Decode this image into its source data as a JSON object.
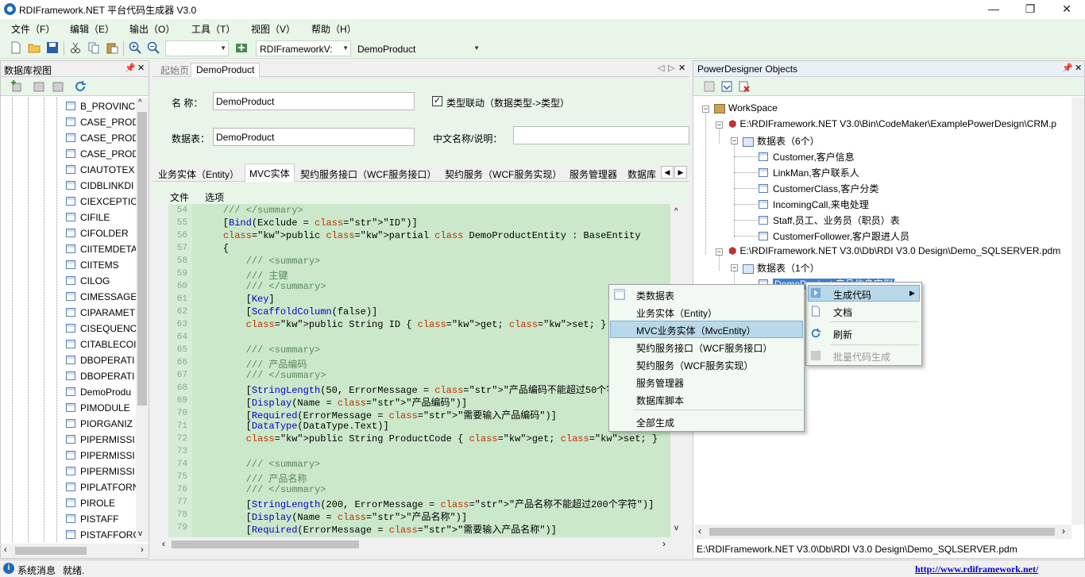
{
  "window": {
    "title": "RDIFramework.NET 平台代码生成器 V3.0",
    "min": "—",
    "max": "❐",
    "close": "✕"
  },
  "menu": [
    "文件（F）",
    "编辑（E）",
    "输出（O）",
    "工具（T）",
    "视图（V）",
    "帮助（H）"
  ],
  "toolbar": {
    "combo1": "",
    "combo2": "RDIFrameworkV:",
    "combo3": "DemoProduct"
  },
  "left_panel": {
    "title": "数据库视图",
    "pin": "📌",
    "close": "✕",
    "items": [
      "B_PROVINC",
      "CASE_PROD",
      "CASE_PROD",
      "CASE_PROD",
      "CIAUTOTEX",
      "CIDBLINKDI",
      "CIEXCEPTIC",
      "CIFILE",
      "CIFOLDER",
      "CIITEMDETA",
      "CIITEMS",
      "CILOG",
      "CIMESSAGE",
      "CIPARAMET",
      "CISEQUENC",
      "CITABLECOI",
      "DBOPERATI",
      "DBOPERATI",
      "DemoProdu",
      "PIMODULE",
      "PIORGANIZ",
      "PIPERMISSI",
      "PIPERMISSI",
      "PIPERMISSI",
      "PIPLATFORN",
      "PIROLE",
      "PISTAFF",
      "PISTAFFORG"
    ]
  },
  "doc_tabs": [
    "起始页",
    "DemoProduct"
  ],
  "form": {
    "name_label": "名  称：",
    "name_value": "DemoProduct",
    "type_link_label": "类型联动（数据类型->类型）",
    "table_label": "数据表：",
    "table_value": "DemoProduct",
    "cn_label": "中文名称/说明：",
    "cn_value": "",
    "checked": "✓"
  },
  "sub_tabs": [
    "业务实体（Entity）",
    "MVC实体",
    "契约服务接口（WCF服务接口）",
    "契约服务（WCF服务实现）",
    "服务管理器",
    "数据库"
  ],
  "sub_menu": [
    "文件",
    "选项"
  ],
  "code": {
    "line_numbers": [
      "54",
      "55",
      "56",
      "57",
      "58",
      "59",
      "60",
      "61",
      "62",
      "63",
      "64",
      "65",
      "66",
      "67",
      "68",
      "69",
      "70",
      "71",
      "72",
      "73",
      "74",
      "75",
      "76",
      "77",
      "78",
      "79"
    ],
    "lines": [
      "    /// </summary>",
      "    [Bind(Exclude = \"ID\")]",
      "    public partial class DemoProductEntity : BaseEntity",
      "    {",
      "        /// <summary>",
      "        /// 主键",
      "        /// </summary>",
      "        [Key]",
      "        [ScaffoldColumn(false)]",
      "        public String ID { get; set; }",
      "",
      "        /// <summary>",
      "        /// 产品编码",
      "        /// </summary>",
      "        [StringLength(50, ErrorMessage = \"产品编码不能超过50个字符\")]",
      "        [Display(Name = \"产品编码\")]",
      "        [Required(ErrorMessage = \"需要输入产品编码\")]",
      "        [DataType(DataType.Text)]",
      "        public String ProductCode { get; set; }",
      "",
      "        /// <summary>",
      "        /// 产品名称",
      "        /// </summary>",
      "        [StringLength(200, ErrorMessage = \"产品名称不能超过200个字符\")]",
      "        [Display(Name = \"产品名称\")]",
      "        [Required(ErrorMessage = \"需要输入产品名称\")]"
    ]
  },
  "right_panel": {
    "title": "PowerDesigner Objects",
    "pin": "📌",
    "close": "✕",
    "workspace": "WorkSpace",
    "model1": "E:\\RDIFramework.NET V3.0\\Bin\\CodeMaker\\ExamplePowerDesign\\CRM.p",
    "folder1": "数据表（6个）",
    "tables1": [
      "Customer,客户信息",
      "LinkMan,客户联系人",
      "CustomerClass,客户分类",
      "IncomingCall,来电处理",
      "Staff,员工、业务员（职员）表",
      "CustomerFollower,客户跟进人员"
    ],
    "model2": "E:\\RDIFramework.NET V3.0\\Db\\RDI V3.0 Design\\Demo_SQLSERVER.pdm",
    "folder2": "数据表（1个）",
    "tables2": [
      "DemoProduct,产品信息实例"
    ],
    "path": "E:\\RDIFramework.NET V3.0\\Db\\RDI V3.0 Design\\Demo_SQLSERVER.pdm"
  },
  "context_menu_main": [
    "生成代码",
    "文档",
    "刷新",
    "批量代码生成"
  ],
  "context_menu_sub": [
    "类数据表",
    "业务实体（Entity）",
    "MVC业务实体（MvcEntity）",
    "契约服务接口（WCF服务接口）",
    "契约服务（WCF服务实现）",
    "服务管理器",
    "数据库脚本",
    "全部生成"
  ],
  "status": {
    "label": "系统消息",
    "text": "就绪.",
    "link": "http://www.rdiframework.net/"
  },
  "colors": {
    "accent": "#eaf5ea",
    "code_bg": "#cbe8cb",
    "highlight": "#b9d9ea"
  }
}
